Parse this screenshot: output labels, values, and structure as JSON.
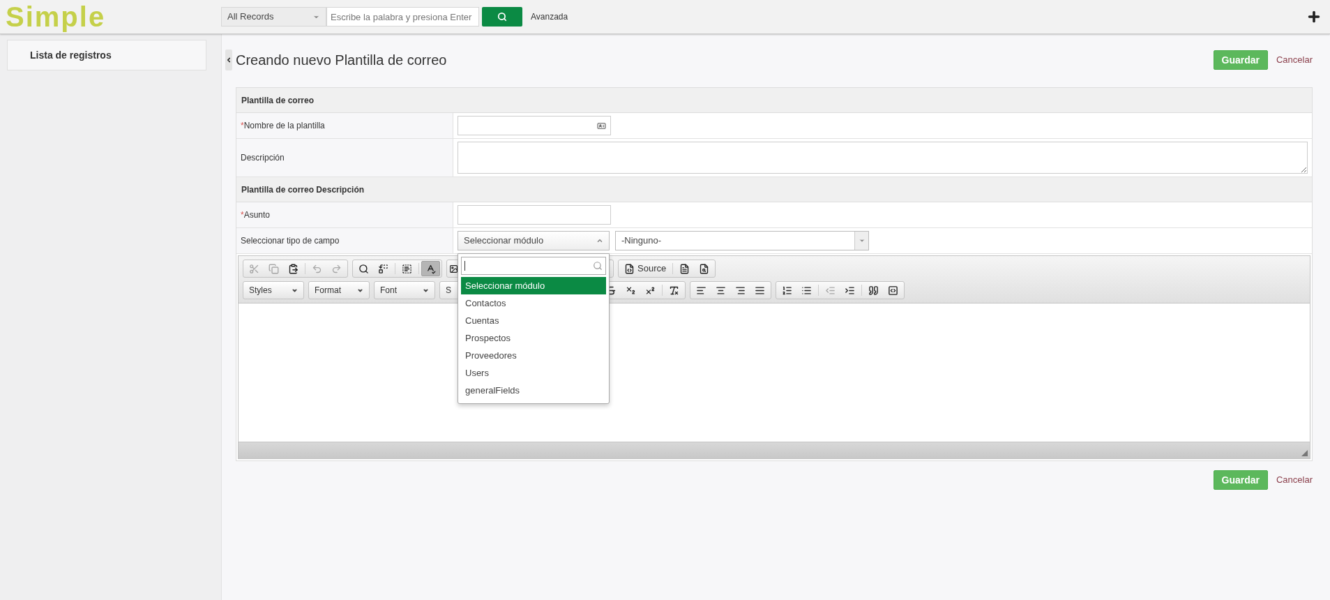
{
  "header": {
    "logo": "Simple",
    "search_scope": "All Records",
    "search": {
      "placeholder": "Escribe la palabra y presiona Enter"
    },
    "advanced_link": "Avanzada"
  },
  "sidebar": {
    "items": [
      {
        "label": "Lista de registros"
      }
    ]
  },
  "page": {
    "title": "Creando nuevo Plantilla de correo",
    "save_button": "Guardar",
    "cancel_link": "Cancelar"
  },
  "required_mark": "*",
  "sections": [
    {
      "title": "Plantilla de correo",
      "rows": [
        {
          "kind": "input",
          "label": "Nombre de la plantilla",
          "required": true
        },
        {
          "kind": "textarea",
          "label": "Descripción",
          "required": false
        }
      ]
    },
    {
      "title": "Plantilla de correo Descripción",
      "rows": [
        {
          "kind": "input",
          "label": "Asunto",
          "required": true
        },
        {
          "kind": "selects",
          "label": "Seleccionar tipo de campo",
          "required": false,
          "module": {
            "value": "Seleccionar módulo",
            "expanded": true,
            "options": [
              {
                "label": "Seleccionar módulo",
                "selected": true
              },
              {
                "label": "Contactos",
                "selected": false
              },
              {
                "label": "Cuentas",
                "selected": false
              },
              {
                "label": "Prospectos",
                "selected": false
              },
              {
                "label": "Proveedores",
                "selected": false
              },
              {
                "label": "Users",
                "selected": false
              },
              {
                "label": "generalFields",
                "selected": false
              }
            ]
          },
          "field": {
            "value": "-Ninguno-"
          }
        }
      ]
    }
  ],
  "editor": {
    "toolbar_row1": [
      [
        {
          "kind": "cut",
          "disabled": true,
          "active": false
        },
        {
          "kind": "copy",
          "disabled": true,
          "active": false
        },
        {
          "kind": "paste",
          "disabled": false,
          "active": false
        },
        {
          "kind": "sep"
        },
        {
          "kind": "undo",
          "disabled": true,
          "active": false
        },
        {
          "kind": "redo",
          "disabled": true,
          "active": false
        }
      ],
      [
        {
          "kind": "find",
          "disabled": false,
          "active": false
        },
        {
          "kind": "replace",
          "disabled": false,
          "active": false
        },
        {
          "kind": "sep"
        },
        {
          "kind": "selectall",
          "disabled": false,
          "active": false
        },
        {
          "kind": "sep"
        },
        {
          "kind": "spellcheck",
          "disabled": false,
          "active": true
        }
      ],
      [
        {
          "kind": "image",
          "disabled": false,
          "active": false
        }
      ],
      [
        {
          "kind": "source",
          "label": "Source",
          "disabled": false,
          "active": false
        },
        {
          "kind": "sep"
        },
        {
          "kind": "templates",
          "disabled": false,
          "active": false
        },
        {
          "kind": "preview",
          "disabled": false,
          "active": false
        }
      ]
    ],
    "combos": [
      "Styles",
      "Format",
      "Font",
      "S"
    ],
    "toolbar_row2": [
      [
        {
          "kind": "strike",
          "disabled": false,
          "active": false
        },
        {
          "kind": "subscript",
          "disabled": false,
          "active": false
        },
        {
          "kind": "superscript",
          "disabled": false,
          "active": false
        },
        {
          "kind": "sep"
        },
        {
          "kind": "removeformat",
          "disabled": false,
          "active": false
        }
      ],
      [
        {
          "kind": "alignleft",
          "disabled": false,
          "active": false
        },
        {
          "kind": "aligncenter",
          "disabled": false,
          "active": false
        },
        {
          "kind": "alignright",
          "disabled": false,
          "active": false
        },
        {
          "kind": "justify",
          "disabled": false,
          "active": false
        }
      ],
      [
        {
          "kind": "numbered",
          "disabled": false,
          "active": false
        },
        {
          "kind": "bulleted",
          "disabled": false,
          "active": false
        },
        {
          "kind": "sep"
        },
        {
          "kind": "outdent",
          "disabled": true,
          "active": false
        },
        {
          "kind": "indent",
          "disabled": false,
          "active": false
        },
        {
          "kind": "sep"
        },
        {
          "kind": "blockquote",
          "disabled": false,
          "active": false
        },
        {
          "kind": "div",
          "disabled": false,
          "active": false
        }
      ]
    ]
  },
  "footer": {
    "save_button": "Guardar",
    "cancel_link": "Cancelar"
  }
}
